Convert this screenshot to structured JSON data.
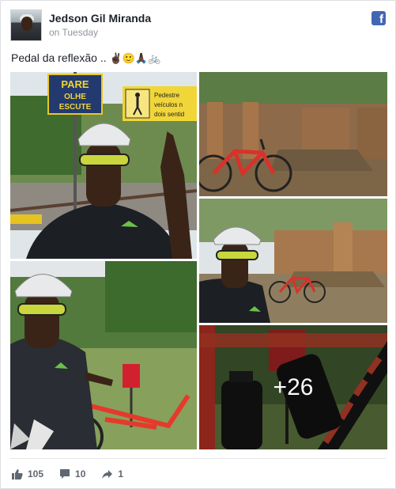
{
  "post": {
    "author": "Jedson Gil Miranda",
    "time": "on Tuesday",
    "text": "Pedal da reflexão .. ",
    "emojis": "✌🏿🙂🙏🏿🚲"
  },
  "photos": {
    "sign_line1": "PARE",
    "sign_line2": "OLHE",
    "sign_line3": "ESCUTE",
    "sign2_line1": "Pedestre",
    "sign2_line2": "veículos n",
    "sign2_line3": "dois sentid",
    "more_count": "+26"
  },
  "stats": {
    "likes": "105",
    "comments": "10",
    "shares": "1"
  },
  "icons": {
    "brand": "facebook-icon",
    "like": "thumbs-up-icon",
    "comment": "comment-icon",
    "share": "share-arrow-icon"
  },
  "colors": {
    "facebook_blue": "#4267b2",
    "meta_gray": "#90949c"
  }
}
